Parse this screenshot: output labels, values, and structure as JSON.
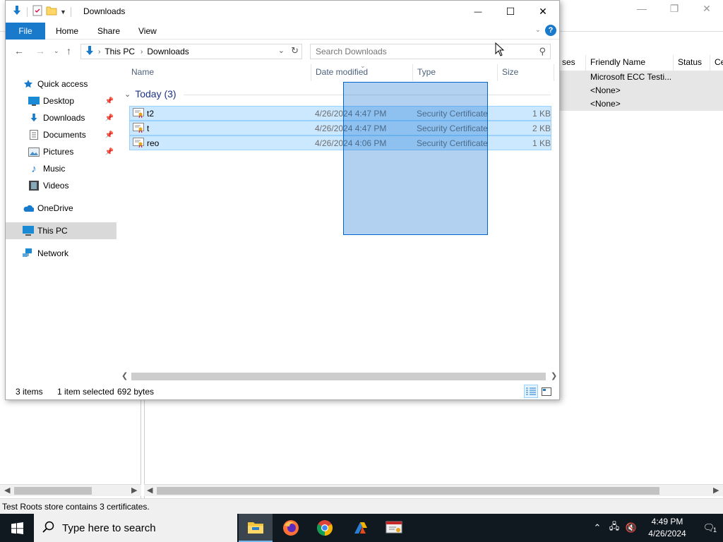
{
  "background_window": {
    "columns": [
      "ses",
      "Friendly Name",
      "Status",
      "Ce"
    ],
    "rows": [
      "Microsoft ECC Testi...",
      "<None>",
      "<None>"
    ],
    "status_text": "Test Roots store contains 3 certificates.",
    "controls": {
      "minimize": "—",
      "maximize": "❐",
      "close": "✕"
    }
  },
  "explorer": {
    "title": "Downloads",
    "controls": {
      "minimize": "—",
      "maximize": "☐",
      "close": "✕"
    },
    "ribbon": {
      "file": "File",
      "home": "Home",
      "share": "Share",
      "view": "View",
      "help": "?"
    },
    "address": {
      "this_pc": "This PC",
      "current": "Downloads"
    },
    "search": {
      "placeholder": "Search Downloads"
    },
    "nav": [
      {
        "label": "Quick access",
        "icon": "star-icon"
      },
      {
        "label": "Desktop",
        "icon": "desktop-icon",
        "pinned": true
      },
      {
        "label": "Downloads",
        "icon": "download-icon",
        "pinned": true
      },
      {
        "label": "Documents",
        "icon": "document-icon",
        "pinned": true
      },
      {
        "label": "Pictures",
        "icon": "pictures-icon",
        "pinned": true
      },
      {
        "label": "Music",
        "icon": "music-icon"
      },
      {
        "label": "Videos",
        "icon": "video-icon"
      },
      {
        "label": "OneDrive",
        "icon": "cloud-icon"
      },
      {
        "label": "This PC",
        "icon": "computer-icon",
        "selected": true
      },
      {
        "label": "Network",
        "icon": "network-icon"
      }
    ],
    "columns": {
      "name": "Name",
      "date": "Date modified",
      "type": "Type",
      "size": "Size"
    },
    "group": "Today (3)",
    "files": [
      {
        "name": "t2",
        "date": "4/26/2024 4:47 PM",
        "type": "Security Certificate",
        "size": "1 KB"
      },
      {
        "name": "t",
        "date": "4/26/2024 4:47 PM",
        "type": "Security Certificate",
        "size": "2 KB"
      },
      {
        "name": "reo",
        "date": "4/26/2024 4:06 PM",
        "type": "Security Certificate",
        "size": "1 KB"
      }
    ],
    "status": {
      "items": "3 items",
      "selected": "1 item selected",
      "size": "692 bytes"
    }
  },
  "taskbar": {
    "search_placeholder": "Type here to search",
    "time": "4:49 PM",
    "date": "4/26/2024",
    "notification_count": "1",
    "apps": [
      "file-explorer-icon",
      "firefox-icon",
      "chrome-icon",
      "app-icon",
      "certificate-manager-icon"
    ]
  },
  "colors": {
    "accent": "#1979ca",
    "selection": "#cce8ff",
    "taskbar": "#101820"
  }
}
